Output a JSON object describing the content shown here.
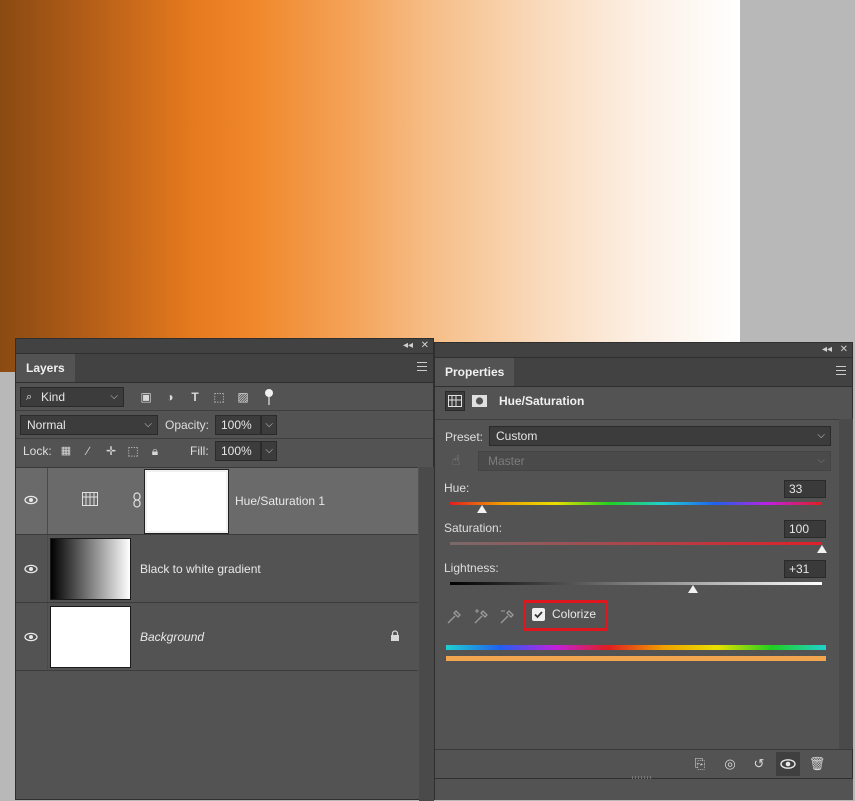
{
  "layers_panel": {
    "tab_label": "Layers",
    "filter_kind": "Kind",
    "blend_mode": "Normal",
    "opacity_label": "Opacity:",
    "opacity_value": "100%",
    "lock_label": "Lock:",
    "fill_label": "Fill:",
    "fill_value": "100%",
    "layers": [
      {
        "name": "Hue/Saturation 1",
        "type": "adjustment",
        "selected": true
      },
      {
        "name": "Black to white gradient",
        "type": "gradient"
      },
      {
        "name": "Background",
        "type": "background",
        "locked": true
      }
    ]
  },
  "properties_panel": {
    "tab_label": "Properties",
    "adjustment_title": "Hue/Saturation",
    "preset_label": "Preset:",
    "preset_value": "Custom",
    "channel_value": "Master",
    "hue_label": "Hue:",
    "hue_value": "33",
    "saturation_label": "Saturation:",
    "saturation_value": "100",
    "lightness_label": "Lightness:",
    "lightness_value": "+31",
    "colorize_label": "Colorize",
    "colorize_checked": true
  },
  "colors": {
    "panel_bg": "#535353",
    "highlight_box": "#e0161f",
    "result_bar": "#f1a54f"
  }
}
